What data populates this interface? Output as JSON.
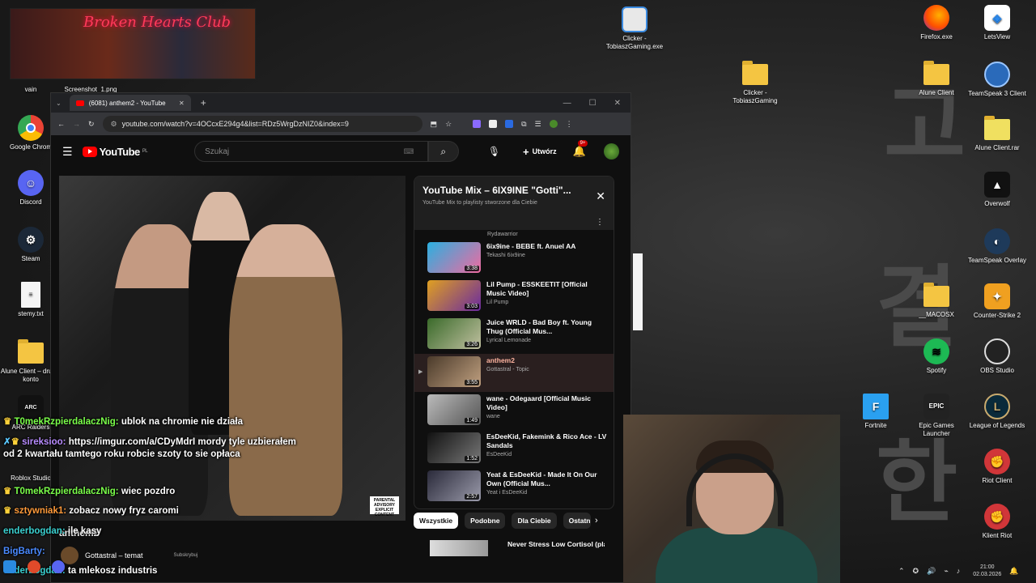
{
  "desktop": {
    "thumbnail_title": "Broken Hearts Club",
    "left_icons": [
      {
        "label": "vain",
        "kind": "label"
      },
      {
        "label": "Screenshot_1.png",
        "kind": "label"
      },
      {
        "label": "Google Chrom",
        "kind": "chrome"
      },
      {
        "label": "Discord",
        "kind": "discord"
      },
      {
        "label": "Steam",
        "kind": "steam"
      },
      {
        "label": "stemy.txt",
        "kind": "text"
      },
      {
        "label": "Alune Client – drugie konto",
        "kind": "folder"
      },
      {
        "label": "ARC Raiders",
        "kind": "arc"
      },
      {
        "label": "Roblox Studio",
        "kind": "roblox"
      }
    ],
    "right_icons": [
      {
        "label": "Clicker - TobiaszGaming.exe"
      },
      {
        "label": "Clicker - TobiaszGaming"
      },
      {
        "label": "Firefox.exe"
      },
      {
        "label": "LetsView"
      },
      {
        "label": "Alune Client"
      },
      {
        "label": "TeamSpeak 3 Client"
      },
      {
        "label": "Alune Client.rar"
      },
      {
        "label": "Overwolf"
      },
      {
        "label": "TeamSpeak Overlay"
      },
      {
        "label": "__MACOSX"
      },
      {
        "label": "Counter-Strike 2"
      },
      {
        "label": "Spotify"
      },
      {
        "label": "OBS Studio"
      },
      {
        "label": "Fortnite"
      },
      {
        "label": "Epic Games Launcher"
      },
      {
        "label": "League of Legends"
      },
      {
        "label": "Riot Client"
      },
      {
        "label": "Klient Riot"
      }
    ],
    "wall_glyphs": [
      "고",
      "결",
      "한"
    ]
  },
  "browser": {
    "tab_title": "(6081) anthem2 - YouTube",
    "new_tab": "+",
    "url": "youtube.com/watch?v=4OCcxE294g4&list=RDz5WrgDzNIZ0&index=9"
  },
  "youtube": {
    "logo": "YouTube",
    "region": "PL",
    "search_placeholder": "Szukaj",
    "create_label": "Utwórz",
    "notif_count": "9+",
    "parental": "PARENTAL ADVISORY EXPLICIT CONTENT",
    "playlist": {
      "title": "YouTube Mix – 6IX9INE \"Gotti\"...",
      "subtitle": "YouTube Mix to playlisty stworzone dla Ciebie",
      "top_channel": "Rydawarrior",
      "items": [
        {
          "title": "6ix9ine - BEBE ft. Anuel AA",
          "channel": "Tekashi 6ix9ine",
          "duration": "3:38"
        },
        {
          "title": "Lil Pump - ESSKEETIT [Official Music Video]",
          "channel": "Lil Pump",
          "duration": "3:03"
        },
        {
          "title": "Juice WRLD - Bad Boy ft. Young Thug (Official Mus...",
          "channel": "Lyrical Lemonade",
          "duration": "3:26"
        },
        {
          "title": "anthem2",
          "channel": "Gottastral - Topic",
          "duration": "3:55"
        },
        {
          "title": "wane - Odegaard [Official Music Video]",
          "channel": "wane",
          "duration": "1:49"
        },
        {
          "title": "EsDeeKid, Fakemink & Rico Ace - LV Sandals",
          "channel": "EsDeeKid",
          "duration": "1:52"
        },
        {
          "title": "Yeat & EsDeeKid - Made It On Our Own (Official Mus...",
          "channel": "Yeat i EsDeeKid",
          "duration": "2:57"
        }
      ]
    },
    "chips": [
      "Wszystkie",
      "Podobne",
      "Dla Ciebie",
      "Ostatnio"
    ],
    "rec_title": "Never Stress Low Cortisol (playlist)",
    "below_title": "anthem2",
    "channel_line": "Gottastral – temat",
    "subscribe": "Subskrybuj"
  },
  "chat": [
    {
      "user": "T0mekRzpierdalaczNig:",
      "msg": "ublok na chromie nie działa",
      "color": "#7bff4a"
    },
    {
      "user": "sireksioo:",
      "msg": "https://imgur.com/a/CDyMdrI mordy tyle uzbierałem od 2 kwartału tamtego roku robcie szoty to sie opłaca",
      "color": "#b88cff"
    },
    {
      "user": "T0mekRzpierdalaczNig:",
      "msg": "wiec pozdro",
      "color": "#7bff4a"
    },
    {
      "user": "sztywniak1:",
      "msg": "zobacz nowy fryz caromi",
      "color": "#ff9a3a"
    },
    {
      "user": "enderbogdan:",
      "msg": "ile kasy",
      "color": "#3ad0d0"
    },
    {
      "user": "BigBarty:",
      "msg": "",
      "color": "#4a8aff"
    },
    {
      "user": "enderbogdan:",
      "msg": "ta mlekosz industris",
      "color": "#3ad0d0"
    }
  ],
  "tray": {
    "time": "21:00",
    "date": "02.03.2026"
  }
}
